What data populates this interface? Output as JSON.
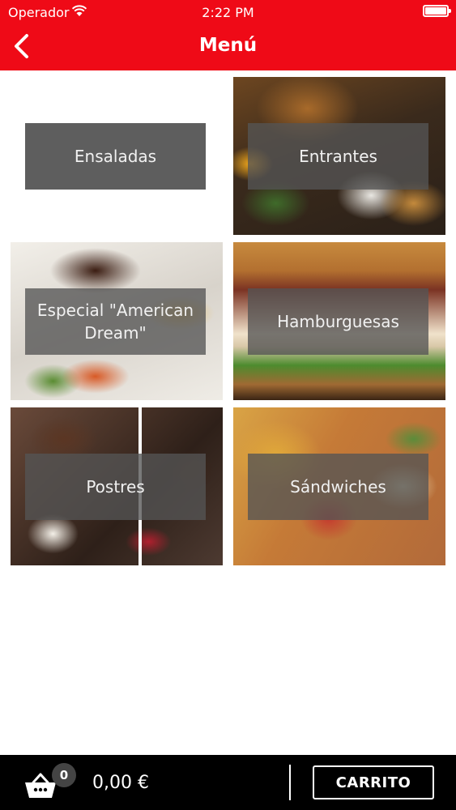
{
  "status_bar": {
    "carrier": "Operador",
    "time": "2:22 PM"
  },
  "nav": {
    "title": "Menú",
    "back_icon": "chevron-left-icon"
  },
  "categories": [
    {
      "label": "Ensaladas"
    },
    {
      "label": "Entrantes"
    },
    {
      "label": "Especial \"American Dream\""
    },
    {
      "label": "Hamburguesas"
    },
    {
      "label": "Postres"
    },
    {
      "label": "Sándwiches"
    }
  ],
  "bottom_bar": {
    "basket_icon": "basket-icon",
    "item_count": "0",
    "total": "0,00 €",
    "cart_button": "CARRITO"
  },
  "colors": {
    "header_bg": "#ef0a17",
    "bottom_bg": "#000000",
    "label_bg": "#5e5e5e"
  }
}
